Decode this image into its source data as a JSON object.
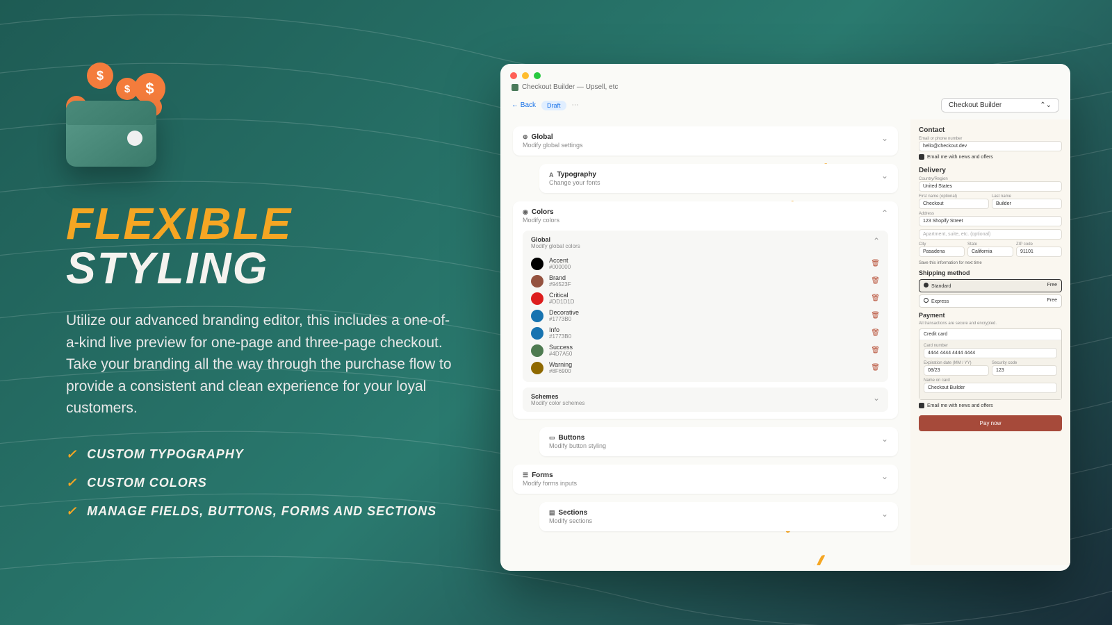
{
  "marketing": {
    "headline1": "FLEXIBLE",
    "headline2": "STYLING",
    "description": "Utilize our advanced branding editor, this includes a one-of-a-kind live preview for one-page and three-page checkout. Take your branding all the way through the purchase flow to provide a consistent and clean experience for your loyal customers.",
    "features": [
      "Custom Typography",
      "Custom Colors",
      "Manage Fields, Buttons, Forms and Sections"
    ]
  },
  "app": {
    "breadcrumb": "Checkout Builder — Upsell, etc",
    "back": "Back",
    "draft": "Draft",
    "selector": "Checkout Builder"
  },
  "sections": {
    "global": {
      "title": "Global",
      "sub": "Modify global settings"
    },
    "typography": {
      "title": "Typography",
      "sub": "Change your fonts"
    },
    "colors": {
      "title": "Colors",
      "sub": "Modify colors",
      "globalTitle": "Global",
      "globalSub": "Modify global colors",
      "schemesTitle": "Schemes",
      "schemesSub": "Modify color schemes",
      "items": [
        {
          "name": "Accent",
          "hex": "#000000",
          "swatch": "#000000"
        },
        {
          "name": "Brand",
          "hex": "#94523F",
          "swatch": "#94523F"
        },
        {
          "name": "Critical",
          "hex": "#DD1D1D",
          "swatch": "#DD1D1D"
        },
        {
          "name": "Decorative",
          "hex": "#1773B0",
          "swatch": "#1773B0"
        },
        {
          "name": "Info",
          "hex": "#1773B0",
          "swatch": "#1773B0"
        },
        {
          "name": "Success",
          "hex": "#4D7A50",
          "swatch": "#4D7A50"
        },
        {
          "name": "Warning",
          "hex": "#8F6900",
          "swatch": "#8F6900"
        }
      ]
    },
    "buttons": {
      "title": "Buttons",
      "sub": "Modify button styling"
    },
    "forms": {
      "title": "Forms",
      "sub": "Modify forms inputs"
    },
    "sectionsCard": {
      "title": "Sections",
      "sub": "Modify sections"
    }
  },
  "preview": {
    "contactTitle": "Contact",
    "emailLabel": "Email or phone number",
    "email": "hello@checkout.dev",
    "newsOffers": "Email me with news and offers",
    "deliveryTitle": "Delivery",
    "countryLabel": "Country/Region",
    "country": "United States",
    "firstLabel": "First name (optional)",
    "first": "Checkout",
    "lastLabel": "Last name",
    "last": "Builder",
    "addressLabel": "Address",
    "address": "123 Shopify Street",
    "aptLabel": "Apartment, suite, etc. (optional)",
    "cityLabel": "City",
    "city": "Pasadena",
    "stateLabel": "State",
    "state": "California",
    "zipLabel": "ZIP code",
    "zip": "91101",
    "saveInfo": "Save this information for next time",
    "shippingTitle": "Shipping method",
    "shipStandard": "Standard",
    "shipExpress": "Express",
    "free": "Free",
    "paymentTitle": "Payment",
    "paymentNote": "All transactions are secure and encrypted.",
    "creditCard": "Credit card",
    "cardNumLabel": "Card number",
    "cardNum": "4444 4444 4444 4444",
    "expLabel": "Expiration date (MM / YY)",
    "exp": "08/23",
    "secLabel": "Security code",
    "sec": "123",
    "nameLabel": "Name on card",
    "nameOnCard": "Checkout Builder",
    "payNow": "Pay now"
  }
}
